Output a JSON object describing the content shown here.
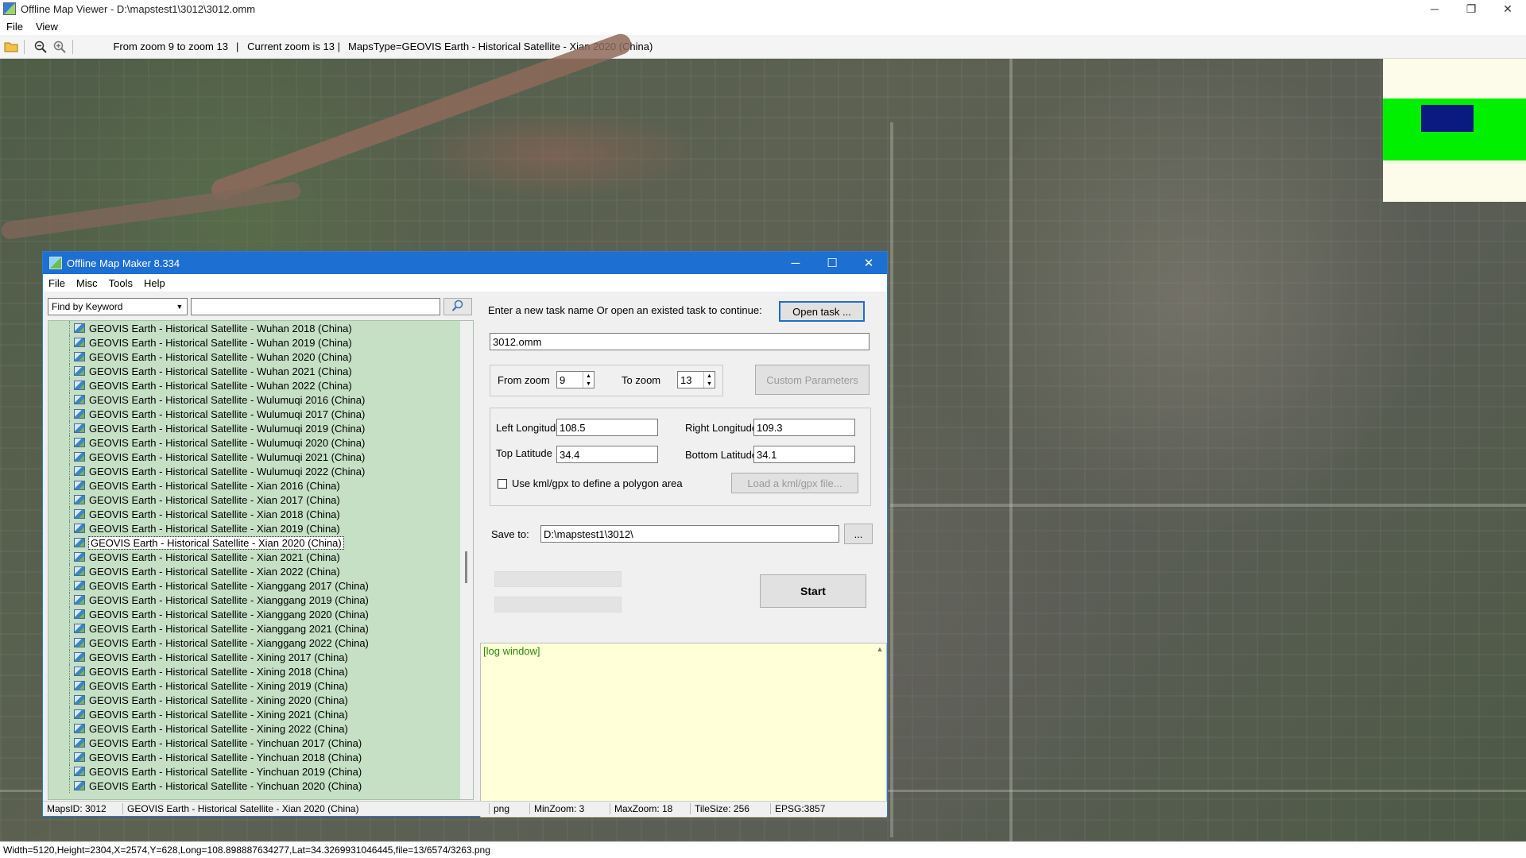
{
  "window": {
    "title": "Offline Map Viewer - D:\\mapstest1\\3012\\3012.omm",
    "controls": {
      "minimize": "─",
      "restore": "❐",
      "close": "✕"
    }
  },
  "menu": [
    "File",
    "View"
  ],
  "toolbar": {
    "zoom_range": "From zoom 9 to zoom 13",
    "current_zoom": "|   Current zoom is 13 |",
    "maps_type": "MapsType=GEOVIS Earth - Historical Satellite - Xian 2020 (China)"
  },
  "statusbar": "Width=5120,Height=2304,X=2574,Y=628,Long=108.898887634277,Lat=34.3269931046445,file=13/6574/3263.png",
  "dialog": {
    "title": "Offline Map Maker 8.334",
    "controls": {
      "minimize": "─",
      "maximize": "☐",
      "close": "✕"
    },
    "menu": [
      "File",
      "Misc",
      "Tools",
      "Help"
    ],
    "search": {
      "mode": "Find by Keyword",
      "keyword": ""
    },
    "tree_items": [
      "GEOVIS Earth - Historical Satellite - Wuhan 2018 (China)",
      "GEOVIS Earth - Historical Satellite - Wuhan 2019 (China)",
      "GEOVIS Earth - Historical Satellite - Wuhan 2020 (China)",
      "GEOVIS Earth - Historical Satellite - Wuhan 2021 (China)",
      "GEOVIS Earth - Historical Satellite - Wuhan 2022 (China)",
      "GEOVIS Earth - Historical Satellite - Wulumuqi 2016 (China)",
      "GEOVIS Earth - Historical Satellite - Wulumuqi 2017 (China)",
      "GEOVIS Earth - Historical Satellite - Wulumuqi 2019 (China)",
      "GEOVIS Earth - Historical Satellite - Wulumuqi 2020 (China)",
      "GEOVIS Earth - Historical Satellite - Wulumuqi 2021 (China)",
      "GEOVIS Earth - Historical Satellite - Wulumuqi 2022 (China)",
      "GEOVIS Earth - Historical Satellite - Xian 2016 (China)",
      "GEOVIS Earth - Historical Satellite - Xian 2017 (China)",
      "GEOVIS Earth - Historical Satellite - Xian 2018 (China)",
      "GEOVIS Earth - Historical Satellite - Xian 2019 (China)",
      "GEOVIS Earth - Historical Satellite - Xian 2020 (China)",
      "GEOVIS Earth - Historical Satellite - Xian 2021 (China)",
      "GEOVIS Earth - Historical Satellite - Xian 2022 (China)",
      "GEOVIS Earth - Historical Satellite - Xianggang 2017 (China)",
      "GEOVIS Earth - Historical Satellite - Xianggang 2019 (China)",
      "GEOVIS Earth - Historical Satellite - Xianggang 2020 (China)",
      "GEOVIS Earth - Historical Satellite - Xianggang 2021 (China)",
      "GEOVIS Earth - Historical Satellite - Xianggang 2022 (China)",
      "GEOVIS Earth - Historical Satellite - Xining 2017 (China)",
      "GEOVIS Earth - Historical Satellite - Xining 2018 (China)",
      "GEOVIS Earth - Historical Satellite - Xining 2019 (China)",
      "GEOVIS Earth - Historical Satellite - Xining 2020 (China)",
      "GEOVIS Earth - Historical Satellite - Xining 2021 (China)",
      "GEOVIS Earth - Historical Satellite - Xining 2022 (China)",
      "GEOVIS Earth - Historical Satellite - Yinchuan 2017 (China)",
      "GEOVIS Earth - Historical Satellite - Yinchuan 2018 (China)",
      "GEOVIS Earth - Historical Satellite - Yinchuan 2019 (China)",
      "GEOVIS Earth - Historical Satellite - Yinchuan 2020 (China)"
    ],
    "selected_item": "GEOVIS Earth - Historical Satellite - Xian 2020 (China)",
    "task": {
      "prompt": "Enter a new task name Or open an existed task to continue:",
      "open_button": "Open task ...",
      "name": "3012.omm"
    },
    "zoom": {
      "from_label": "From zoom",
      "from_value": "9",
      "to_label": "To zoom",
      "to_value": "13",
      "custom_button": "Custom Parameters"
    },
    "bounds": {
      "left_label": "Left Longitude",
      "left_value": "108.5",
      "right_label": "Right Longitude",
      "right_value": "109.3",
      "top_label": "Top Latitude",
      "top_value": "34.4",
      "bottom_label": "Bottom Latitude",
      "bottom_value": "34.1",
      "kml_label": "Use kml/gpx to define a polygon area",
      "kml_button": "Load a kml/gpx file..."
    },
    "save": {
      "label": "Save to:",
      "path": "D:\\mapstest1\\3012\\",
      "browse": "..."
    },
    "start_button": "Start",
    "log_title": "[log window]",
    "status": {
      "maps_id": "MapsID: 3012",
      "name": "GEOVIS Earth - Historical Satellite - Xian 2020 (China)",
      "format": "png",
      "min_zoom": "MinZoom: 3",
      "max_zoom": "MaxZoom: 18",
      "tile_size": "TileSize: 256",
      "epsg": "EPSG:3857"
    }
  }
}
